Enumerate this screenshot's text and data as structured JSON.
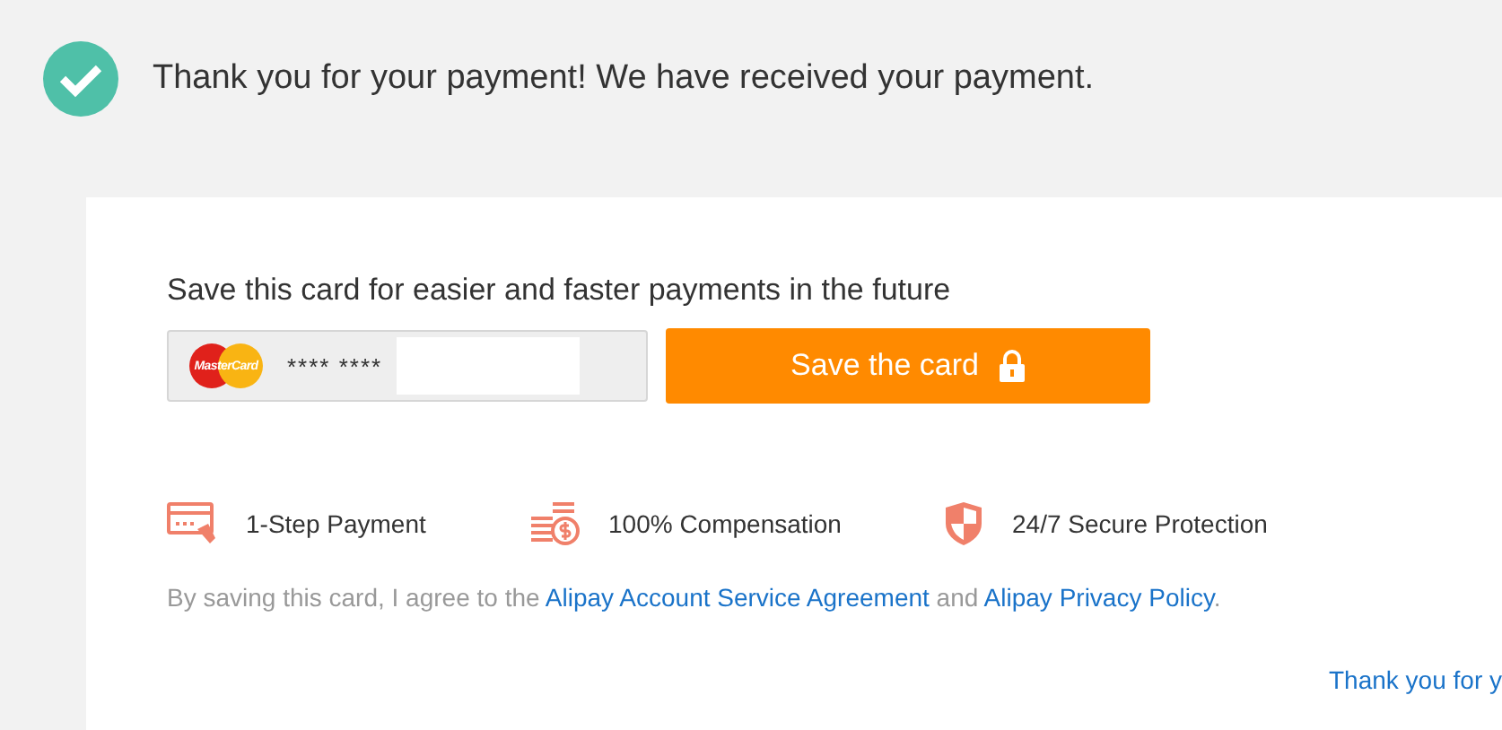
{
  "header": {
    "message": "Thank you for your payment! We have received your payment."
  },
  "save_card": {
    "title": "Save this card for easier and faster payments in the future",
    "card_brand": "MasterCard",
    "masked_number": "**** ****",
    "button": "Save the card"
  },
  "features": [
    {
      "kind": "card",
      "label": "1-Step Payment"
    },
    {
      "kind": "coins",
      "label": "100% Compensation"
    },
    {
      "kind": "shield",
      "label": "24/7 Secure Protection"
    }
  ],
  "agreement": {
    "prefix": "By saving this card, I agree to the ",
    "link_1": "Alipay Account Service Agreement",
    "middle": " and ",
    "link_2": "Alipay Privacy Policy",
    "suffix": "."
  },
  "footer_link": "Thank you for y"
}
